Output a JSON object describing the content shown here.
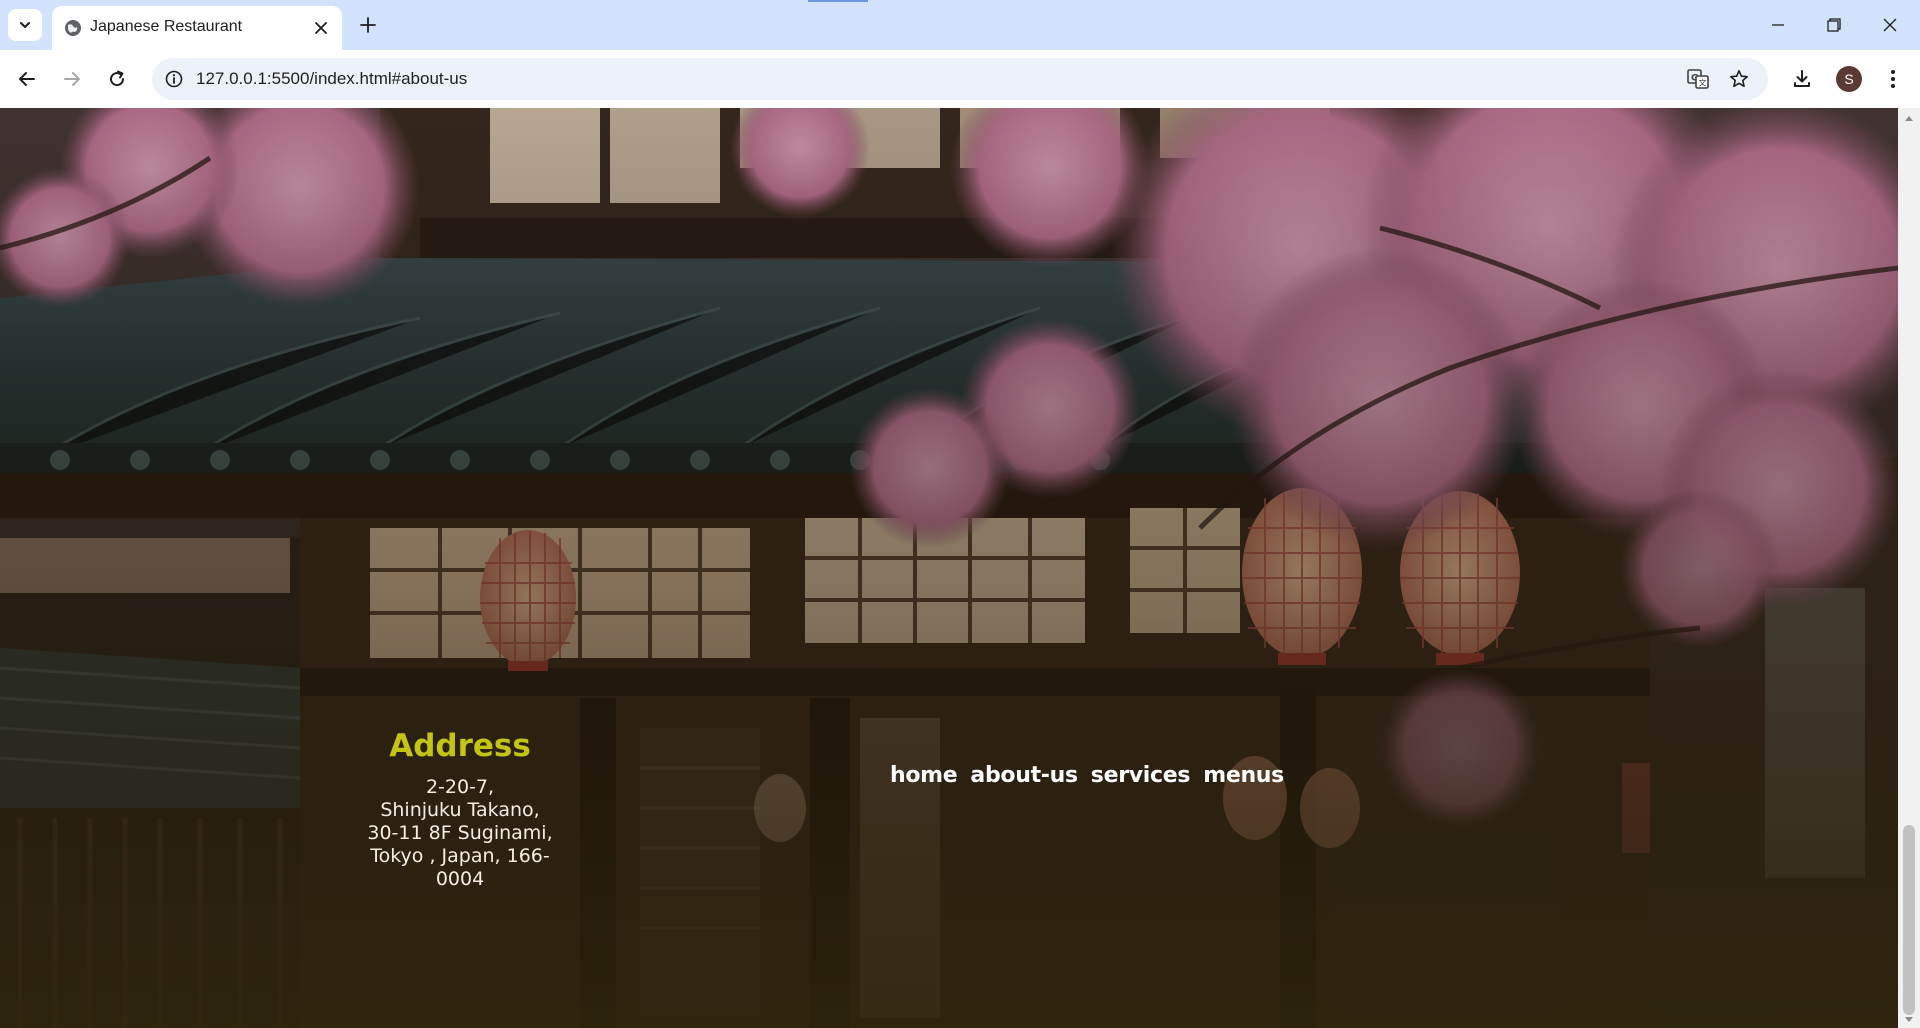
{
  "browser": {
    "tab_title": "Japanese Restaurant",
    "url": "127.0.0.1:5500/index.html#about-us",
    "profile_initial": "S"
  },
  "icons": {
    "tab_search": "chevron-down-icon",
    "favicon": "globe-icon",
    "tab_close": "close-icon",
    "new_tab": "plus-icon",
    "minimize": "minimize-icon",
    "restore": "restore-icon",
    "close_window": "close-icon",
    "back": "arrow-left-icon",
    "forward": "arrow-right-icon",
    "reload": "reload-icon",
    "site_info": "info-icon",
    "translate": "translate-icon",
    "bookmark": "star-icon",
    "downloads": "download-icon",
    "menu": "kebab-menu-icon"
  },
  "footer": {
    "address_title": "Address",
    "address_lines": [
      "2-20-7,",
      "Shinjuku Takano,",
      "30-11 8F Suginami,",
      "Tokyo , Japan, 166-",
      "0004"
    ],
    "nav": [
      {
        "label": "home"
      },
      {
        "label": "about-us"
      },
      {
        "label": "services"
      },
      {
        "label": "menus"
      }
    ]
  },
  "colors": {
    "address_title": "#c3c414",
    "nav_link": "#ffffff",
    "address_text": "#f4eee4",
    "tab_strip": "#d3e3fd"
  }
}
